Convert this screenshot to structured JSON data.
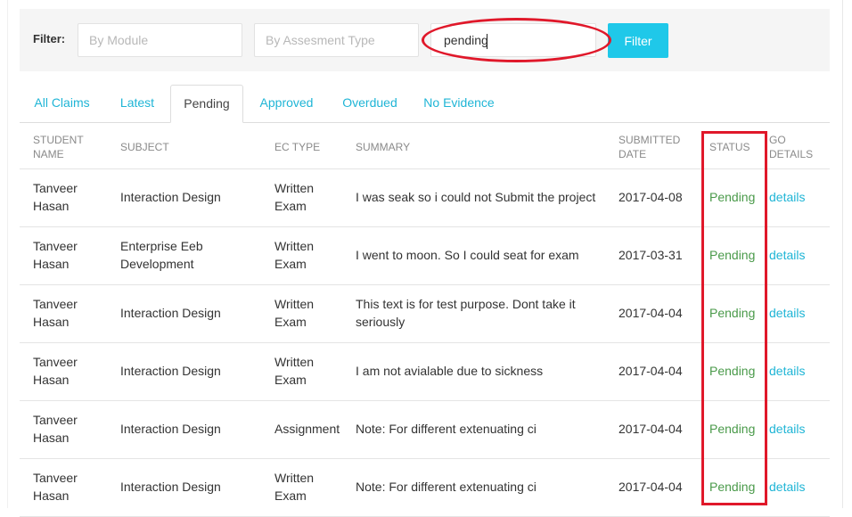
{
  "filter": {
    "label": "Filter:",
    "module_placeholder": "By Module",
    "type_placeholder": "By Assesment Type",
    "status_value": "pending",
    "button_label": "Filter"
  },
  "tabs": [
    {
      "label": "All Claims",
      "active": false
    },
    {
      "label": "Latest",
      "active": false
    },
    {
      "label": "Pending",
      "active": true
    },
    {
      "label": "Approved",
      "active": false
    },
    {
      "label": "Overdued",
      "active": false
    },
    {
      "label": "No Evidence",
      "active": false
    }
  ],
  "table": {
    "headers": {
      "student_1": "STUDENT",
      "student_2": "NAME",
      "subject": "SUBJECT",
      "ec_type": "EC TYPE",
      "summary": "SUMMARY",
      "submitted_1": "SUBMITTED",
      "submitted_2": "DATE",
      "status": "STATUS",
      "go_1": "GO",
      "go_2": "DETAILS"
    },
    "rows": [
      {
        "first": "Tanveer",
        "last": "Hasan",
        "subject": [
          "Interaction Design"
        ],
        "type": [
          "Written",
          "Exam"
        ],
        "summary": [
          "I was seak so i could not Submit the project"
        ],
        "date": "2017-04-08",
        "status": "Pending",
        "link": "details"
      },
      {
        "first": "Tanveer",
        "last": "Hasan",
        "subject": [
          "Enterprise Eeb",
          "Development"
        ],
        "type": [
          "Written",
          "Exam"
        ],
        "summary": [
          "I went to moon. So I could seat for exam"
        ],
        "date": "2017-03-31",
        "status": "Pending",
        "link": "details"
      },
      {
        "first": "Tanveer",
        "last": "Hasan",
        "subject": [
          "Interaction Design"
        ],
        "type": [
          "Written",
          "Exam"
        ],
        "summary": [
          "This text is for test purpose. Dont take it",
          "seriously"
        ],
        "date": "2017-04-04",
        "status": "Pending",
        "link": "details"
      },
      {
        "first": "Tanveer",
        "last": "Hasan",
        "subject": [
          "Interaction Design"
        ],
        "type": [
          "Written",
          "Exam"
        ],
        "summary": [
          "I am not avialable due to sickness"
        ],
        "date": "2017-04-04",
        "status": "Pending",
        "link": "details"
      },
      {
        "first": "Tanveer",
        "last": "Hasan",
        "subject": [
          "Interaction Design"
        ],
        "type": [
          "Assignment"
        ],
        "summary": [
          "Note: For different extenuating ci"
        ],
        "date": "2017-04-04",
        "status": "Pending",
        "link": "details"
      },
      {
        "first": "Tanveer",
        "last": "Hasan",
        "subject": [
          "Interaction Design"
        ],
        "type": [
          "Written",
          "Exam"
        ],
        "summary": [
          "Note: For different extenuating ci"
        ],
        "date": "2017-04-04",
        "status": "Pending",
        "link": "details"
      }
    ]
  },
  "colors": {
    "accent": "#1fc8e9",
    "link": "#1fb5d6",
    "status_pending": "#4a9a4a",
    "annotation": "#e0182a"
  }
}
